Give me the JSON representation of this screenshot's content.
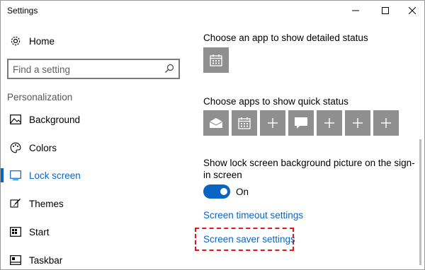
{
  "window": {
    "title": "Settings"
  },
  "sidebar": {
    "home_label": "Home",
    "search_placeholder": "Find a setting",
    "section_title": "Personalization",
    "items": [
      {
        "label": "Background",
        "icon": "image-icon"
      },
      {
        "label": "Colors",
        "icon": "palette-icon"
      },
      {
        "label": "Lock screen",
        "icon": "lock-screen-icon",
        "active": true
      },
      {
        "label": "Themes",
        "icon": "brush-icon"
      },
      {
        "label": "Start",
        "icon": "start-icon"
      },
      {
        "label": "Taskbar",
        "icon": "taskbar-icon"
      }
    ]
  },
  "main": {
    "detailed_status_heading": "Choose an app to show detailed status",
    "quick_status_heading": "Choose apps to show quick status",
    "quick_status_tiles": [
      "mail-icon",
      "calendar-icon",
      "plus-icon",
      "message-icon",
      "plus-icon",
      "plus-icon",
      "plus-icon"
    ],
    "signin_heading": "Show lock screen background picture on the sign-in screen",
    "toggle_state": "On",
    "screen_timeout_link": "Screen timeout settings",
    "screen_saver_link": "Screen saver settings"
  },
  "colors": {
    "accent": "#0a64c2",
    "tile": "#8f8f8f",
    "highlight": "#e3141c"
  }
}
